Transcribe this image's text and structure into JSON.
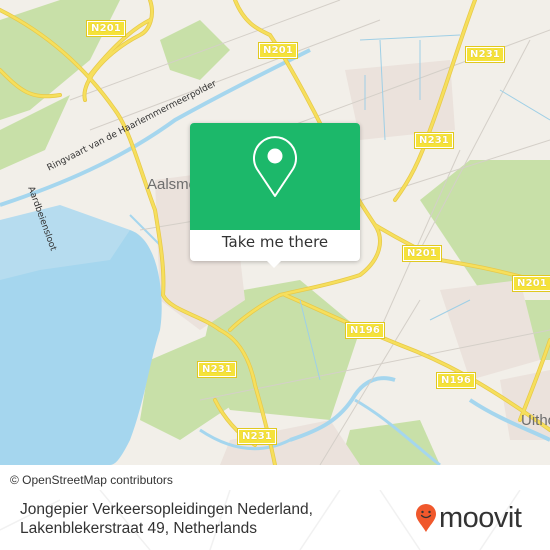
{
  "map": {
    "road_shields": [
      {
        "label": "N201",
        "id": "n201-northwest"
      },
      {
        "label": "N201",
        "id": "n201-north"
      },
      {
        "label": "N231",
        "id": "n231-northeast"
      },
      {
        "label": "N231",
        "id": "n231-east"
      },
      {
        "label": "N201",
        "id": "n201-center"
      },
      {
        "label": "N201",
        "id": "n201-east"
      },
      {
        "label": "N196",
        "id": "n196-center"
      },
      {
        "label": "N196",
        "id": "n196-east"
      },
      {
        "label": "N231",
        "id": "n231-south"
      },
      {
        "label": "N231",
        "id": "n231-southwest"
      }
    ],
    "place_labels": {
      "aalsmeer": "Aalsmeer",
      "uithoorn": "Uithoorn"
    },
    "street_labels": {
      "ringvaart": "Ringvaart van de Haarlemmermeerpolder",
      "aardbeiensloot": "Aardbeiensloot"
    },
    "colors": {
      "water": "#a5d6ee",
      "land": "#f2efe9",
      "green": "#c8e0a8",
      "road": "#f6df5c",
      "road_edge": "#e7c94a",
      "accent": "#1cb86a",
      "brand": "#f0582c"
    }
  },
  "popup": {
    "icon": "map-pin-icon",
    "button_label": "Take me there"
  },
  "attribution": "© OpenStreetMap contributors",
  "footer": {
    "address_line1": "Jongepier Verkeersopleidingen Nederland,",
    "address_line2": "Lakenblekerstraat 49, Netherlands",
    "brand": "moovit"
  }
}
